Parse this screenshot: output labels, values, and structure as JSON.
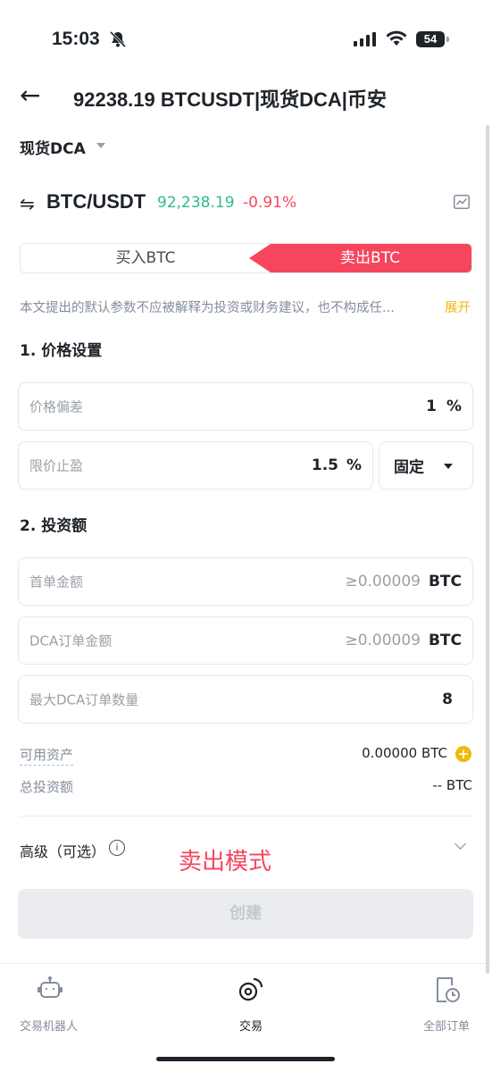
{
  "status": {
    "time": "15:03",
    "battery": "54"
  },
  "header": {
    "back_icon": "arrow-left-icon",
    "title": "92238.19 BTCUSDT|现货DCA|币安"
  },
  "mode_selector": {
    "label": "现货DCA"
  },
  "ticker": {
    "pair": "BTC/USDT",
    "price": "92,238.19",
    "change": "-0.91%",
    "colors": {
      "up": "#2ebd85",
      "down": "#f6465d"
    }
  },
  "tabs": {
    "buy": "买入BTC",
    "sell": "卖出BTC",
    "active": "sell"
  },
  "disclaimer": {
    "text": "本文提出的默认参数不应被解释为投资或财务建议，也不构成任...",
    "expand": "展开"
  },
  "price_section": {
    "title": "1. 价格设置",
    "deviation": {
      "placeholder": "价格偏差",
      "value": "1",
      "unit": "%"
    },
    "take_profit": {
      "placeholder": "限价止盈",
      "value": "1.5",
      "unit": "%"
    },
    "tp_mode": {
      "value": "固定"
    }
  },
  "invest_section": {
    "title": "2. 投资额",
    "first_order": {
      "placeholder": "首单金额",
      "value": "≥0.00009",
      "unit": "BTC"
    },
    "dca_order": {
      "placeholder": "DCA订单金额",
      "value": "≥0.00009",
      "unit": "BTC"
    },
    "max_orders": {
      "placeholder": "最大DCA订单数量",
      "value": "8"
    }
  },
  "summary": {
    "available_label": "可用资产",
    "available_value": "0.00000 BTC",
    "total_label": "总投资额",
    "total_value": "-- BTC"
  },
  "advanced": {
    "label": "高级（可选）",
    "annotation": "卖出模式"
  },
  "create_button": {
    "label": "创建"
  },
  "bottom_nav": [
    {
      "label": "交易机器人",
      "icon": "robot-icon"
    },
    {
      "label": "交易",
      "icon": "trade-icon"
    },
    {
      "label": "全部订单",
      "icon": "orders-icon"
    }
  ],
  "accent_color": "#f0b90b",
  "sell_color": "#f6465d"
}
